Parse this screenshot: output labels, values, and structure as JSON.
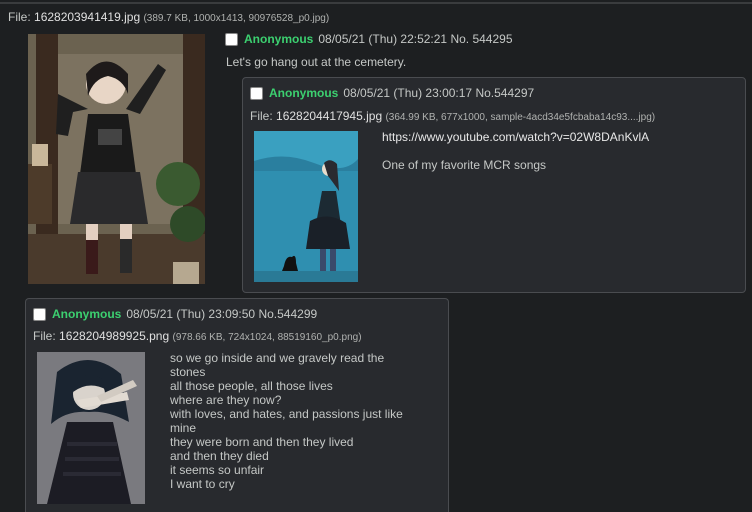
{
  "op": {
    "file_label": "File:",
    "filename": "1628203941419.jpg",
    "filemeta": "(389.7 KB, 1000x1413, 90976528_p0.jpg)",
    "name": "Anonymous",
    "date": "08/05/21 (Thu) 22:52:21",
    "no": "No. 544295",
    "text": "Let's go hang out at the cemetery."
  },
  "reply1": {
    "name": "Anonymous",
    "date": "08/05/21 (Thu) 23:00:17",
    "no": "No.544297",
    "file_label": "File:",
    "filename": "1628204417945.jpg",
    "filemeta": "(364.99 KB, 677x1000, sample-4acd34e5fcbaba14c93....jpg)",
    "link": "https://www.youtube.com/watch?v=02W8DAnKvlA",
    "text": "One of my favorite MCR songs"
  },
  "reply2": {
    "name": "Anonymous",
    "date": "08/05/21 (Thu) 23:09:50",
    "no": "No.544299",
    "file_label": "File:",
    "filename": "1628204989925.png",
    "filemeta": "(978.66 KB, 724x1024, 88519160_p0.png)",
    "lines": [
      "so we go inside and we gravely read the",
      "stones",
      "all those people, all those lives",
      "where are they now?",
      "with loves, and hates, and passions just like",
      "mine",
      "they were born and then they lived",
      "and then they died",
      "it seems so unfair",
      "I want to cry"
    ]
  },
  "colors": {
    "name": "#3cd070",
    "background": "#1d1f21",
    "reply_bg": "#282a2e"
  }
}
